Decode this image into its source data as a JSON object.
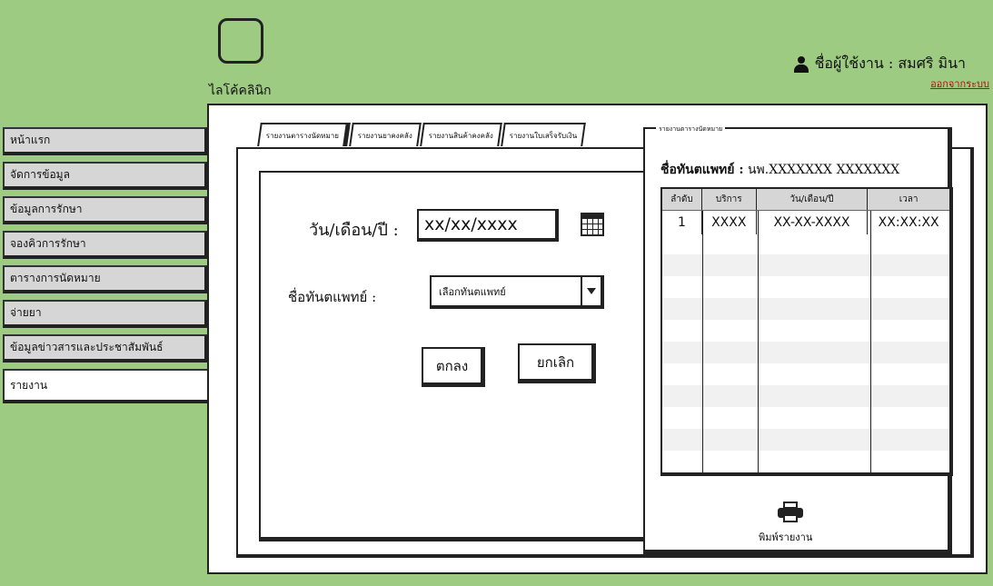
{
  "app": {
    "logo_text": "ไลโค้คลินิก"
  },
  "user": {
    "label": "ชื่อผู้ใช้งาน : สมศริ  มินา",
    "logout": "ออกจากระบบ"
  },
  "sidebar": {
    "items": [
      {
        "label": "หน้าแรก"
      },
      {
        "label": "จัดการข้อมูล"
      },
      {
        "label": "ข้อมูลการรักษา"
      },
      {
        "label": "จองคิวการรักษา"
      },
      {
        "label": "ตารางการนัดหมาย"
      },
      {
        "label": "จ่ายยา"
      },
      {
        "label": "ข้อมูลข่าวสารและประชาสัมพันธ์"
      },
      {
        "label": "รายงาน"
      }
    ]
  },
  "tabs": [
    {
      "label": "รายงานตารางนัดหมาย"
    },
    {
      "label": "รายงานยาคงคลัง"
    },
    {
      "label": "รายงานสินค้าคงคลัง"
    },
    {
      "label": "รายงานใบเสร็จรับเงิน"
    }
  ],
  "form": {
    "date_label": "วัน/เดือน/ปี :",
    "date_value": "xx/xx/xxxx",
    "dentist_label": "ชื่อทันตแพทย์ :",
    "dentist_select": "เลือกทันตแพทย์",
    "ok": "ตกลง",
    "cancel": "ยกเลิก"
  },
  "report": {
    "title": "รายงานตารางนัดหมาย",
    "dentist_label": "ชื่อทันตแพทย์ :",
    "dentist_value": "นพ.XXXXXXX  XXXXXXX",
    "columns": [
      "ลำดับ",
      "บริการ",
      "วัน/เดือน/ปี",
      "เวลา"
    ],
    "rows": [
      [
        "1",
        "XXXX",
        "XX-XX-XXXX",
        "XX:XX:XX"
      ]
    ],
    "print_label": "พิมพ์รายงาน"
  }
}
